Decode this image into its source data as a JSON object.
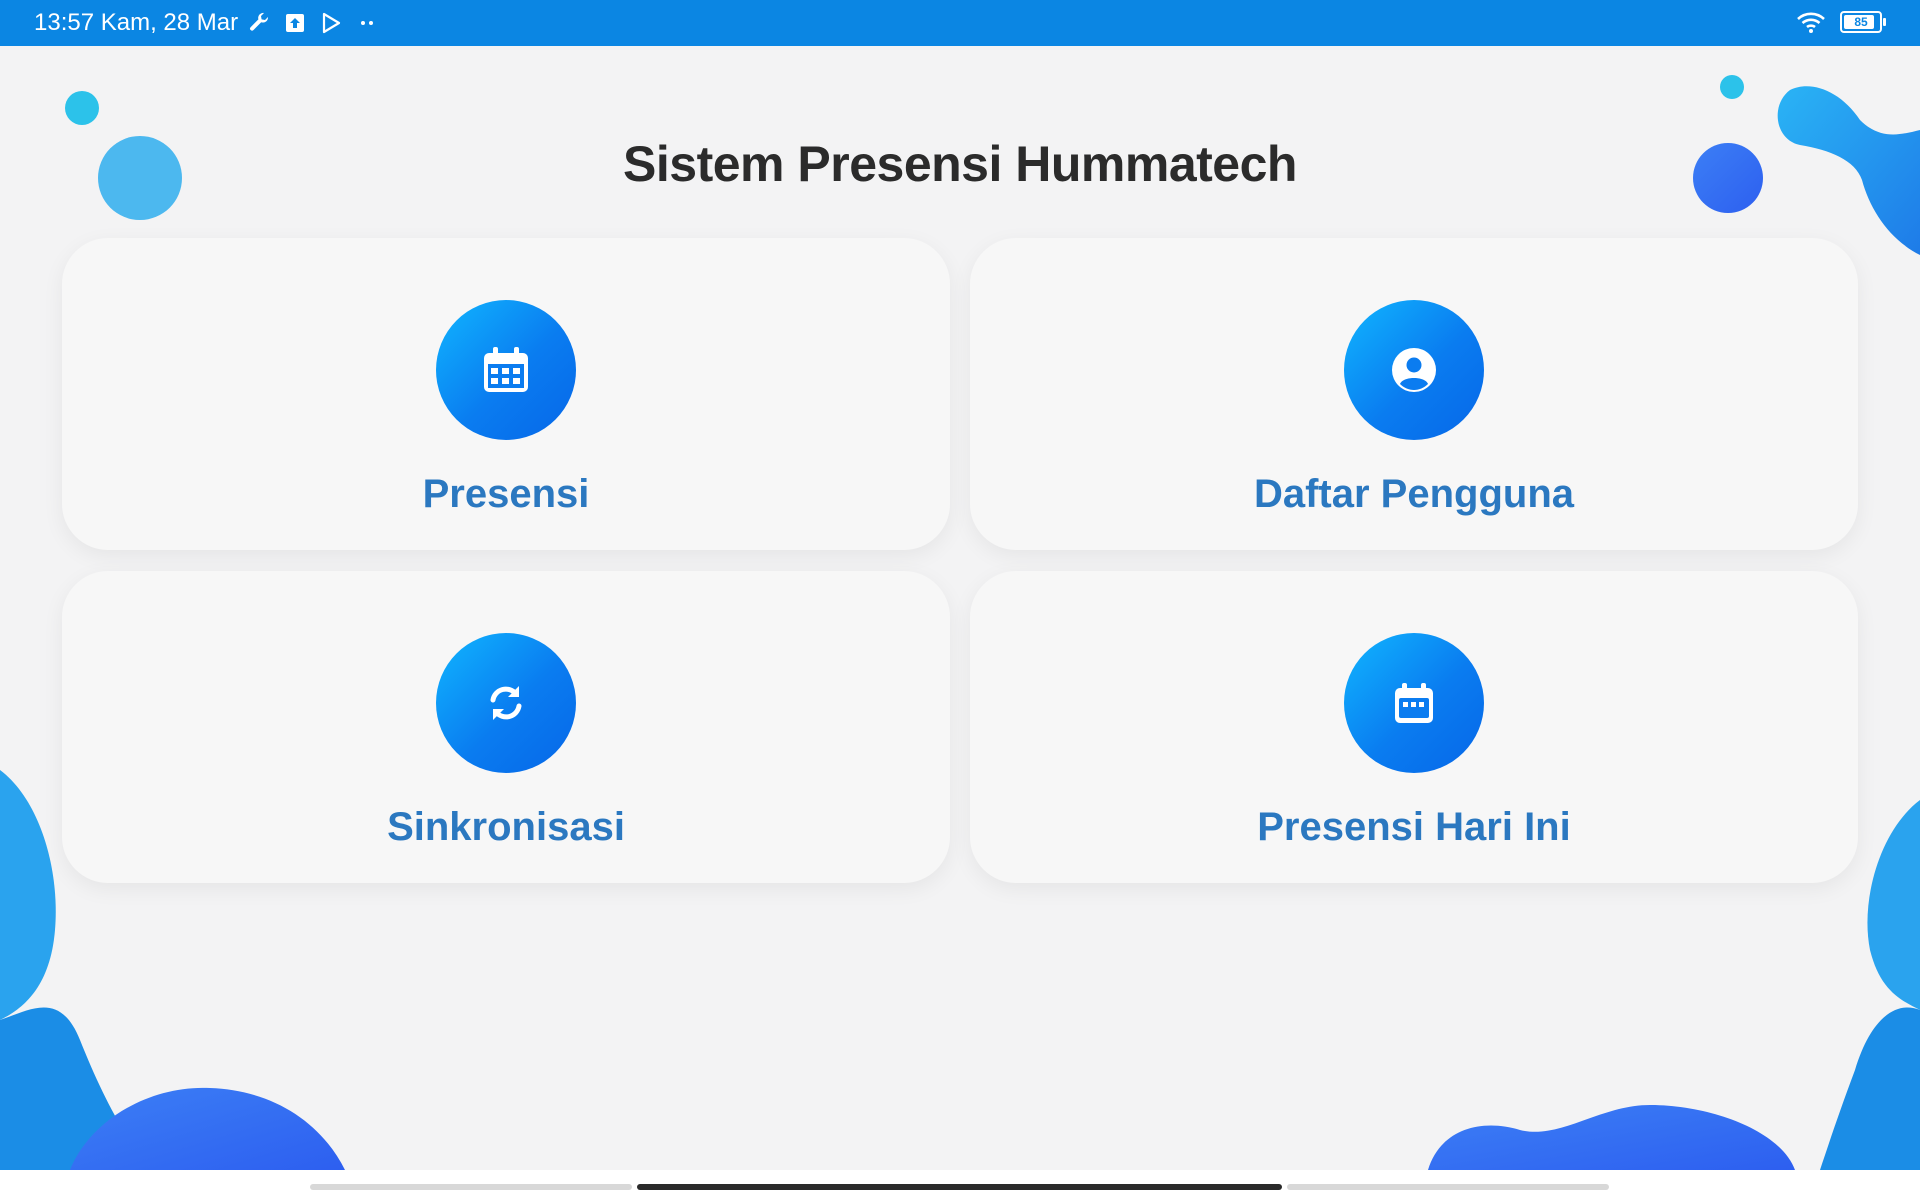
{
  "status_bar": {
    "time_date": "13:57 Kam, 28 Mar",
    "battery_level": "85",
    "icons": [
      "wrench-icon",
      "upload-icon",
      "play-store-icon",
      "more-dots-icon",
      "wifi-icon",
      "battery-icon"
    ]
  },
  "app": {
    "title": "Sistem Presensi Hummatech",
    "accent_color": "#0b86e3",
    "label_color": "#2b78c0"
  },
  "menu": [
    {
      "label": "Presensi",
      "icon": "calendar-grid-icon"
    },
    {
      "label": "Daftar Pengguna",
      "icon": "user-circle-icon"
    },
    {
      "label": "Sinkronisasi",
      "icon": "sync-icon"
    },
    {
      "label": "Presensi Hari Ini",
      "icon": "calendar-today-icon"
    }
  ]
}
